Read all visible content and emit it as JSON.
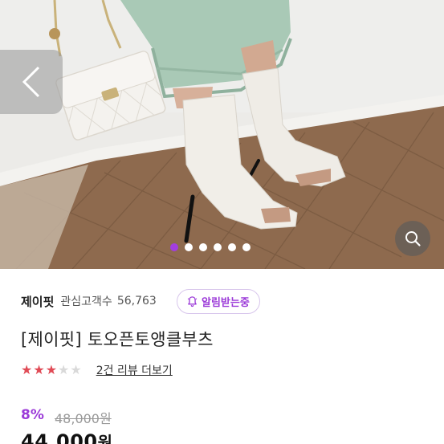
{
  "gallery": {
    "dot_count": 6,
    "active_dot_index": 0,
    "prev_icon": "chevron-left-icon",
    "zoom_icon": "search-icon"
  },
  "shop": {
    "name": "제이핏",
    "followers_label": "관심고객수",
    "followers_count": "56,763",
    "alarm_label": "알림받는중",
    "alarm_icon": "bell-icon"
  },
  "product": {
    "title": "[제이핏] 토오픈토앵클부츠"
  },
  "rating": {
    "stars": 3,
    "max_stars": 5,
    "review_link": "2건 리뷰 더보기"
  },
  "price": {
    "discount": "8%",
    "original": "48,000원",
    "sale_amount": "44,000",
    "sale_unit": "원"
  },
  "colors": {
    "accent_purple": "#9b3ad8",
    "star_red": "#e04a55"
  }
}
